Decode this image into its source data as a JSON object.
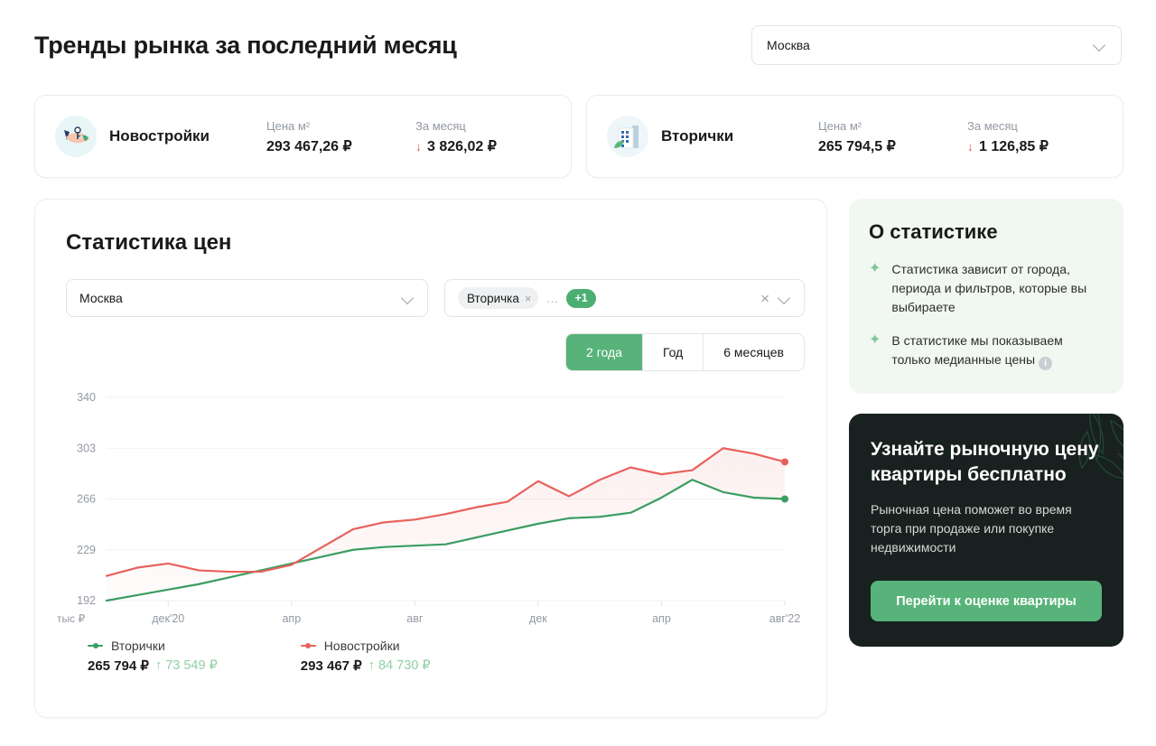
{
  "header": {
    "title": "Тренды рынка за последний месяц",
    "city_select": {
      "value": "Москва",
      "chevron_icon": "chevron-down-icon"
    }
  },
  "summary": [
    {
      "icon": "keys-in-hand-icon",
      "name": "Новостройки",
      "price_label": "Цена м²",
      "price_value": "293 467,26 ₽",
      "month_label": "За месяц",
      "month_arrow": "↓",
      "month_value": "3 826,02 ₽"
    },
    {
      "icon": "building-icon",
      "name": "Вторички",
      "price_label": "Цена м²",
      "price_value": "265 794,5 ₽",
      "month_label": "За месяц",
      "month_arrow": "↓",
      "month_value": "1 126,85 ₽"
    }
  ],
  "stats": {
    "title": "Статистика цен",
    "city_filter": {
      "value": "Москва"
    },
    "type_filter": {
      "chip": "Вторичка",
      "chip_close": "×",
      "dots": "…",
      "more_badge": "+1",
      "clear": "×"
    },
    "periods": [
      {
        "label": "2 года",
        "active": true
      },
      {
        "label": "Год",
        "active": false
      },
      {
        "label": "6 месяцев",
        "active": false
      }
    ],
    "legend": [
      {
        "name": "Вторички",
        "color": "#3a9d62",
        "value": "265 794 ₽",
        "delta_arrow": "↑",
        "delta": "73 549 ₽"
      },
      {
        "name": "Новостройки",
        "color": "#e8615c",
        "value": "293 467 ₽",
        "delta_arrow": "↑",
        "delta": "84 730 ₽"
      }
    ]
  },
  "chart_data": {
    "type": "line",
    "title": "Статистика цен",
    "xlabel": "",
    "ylabel": "тыс ₽",
    "y_unit": "тыс ₽",
    "ylim": [
      192,
      340
    ],
    "yticks": [
      192,
      229,
      266,
      303,
      340
    ],
    "grid": true,
    "legend_position": "bottom-left",
    "x_tick_labels": [
      "дек'20",
      "апр",
      "авг",
      "дек",
      "апр",
      "авг'22"
    ],
    "x": [
      "окт'20",
      "ноя'20",
      "дек'20",
      "янв'21",
      "фев'21",
      "мар'21",
      "апр'21",
      "май'21",
      "июн'21",
      "июл'21",
      "авг'21",
      "сен'21",
      "окт'21",
      "ноя'21",
      "дек'21",
      "янв'22",
      "фев'22",
      "мар'22",
      "апр'22",
      "май'22",
      "июн'22",
      "июл'22",
      "авг'22"
    ],
    "series": [
      {
        "name": "Вторички",
        "color": "#3a9d62",
        "values": [
          192,
          196,
          200,
          204,
          209,
          214,
          219,
          224,
          229,
          231,
          232,
          233,
          238,
          243,
          248,
          252,
          253,
          256,
          267,
          280,
          271,
          267,
          266
        ]
      },
      {
        "name": "Новостройки",
        "color": "#e8615c",
        "values": [
          210,
          216,
          219,
          214,
          213,
          213,
          218,
          231,
          244,
          249,
          251,
          255,
          260,
          264,
          279,
          268,
          280,
          289,
          284,
          287,
          303,
          299,
          293
        ]
      }
    ]
  },
  "about": {
    "title": "О статистике",
    "items": [
      {
        "bullet": "sparkle-icon",
        "text": "Статистика зависит от города, периода и фильтров, которые вы выбираете"
      },
      {
        "bullet": "sparkle-icon",
        "text": "В статистике мы показываем только медианные цены"
      }
    ],
    "info_icon": "i"
  },
  "promo": {
    "title": "Узнайте рыночную цену квартиры бесплатно",
    "text": "Рыночная цена поможет во время торга при продаже или покупке недвижимости",
    "button": "Перейти к оценке квартиры"
  }
}
